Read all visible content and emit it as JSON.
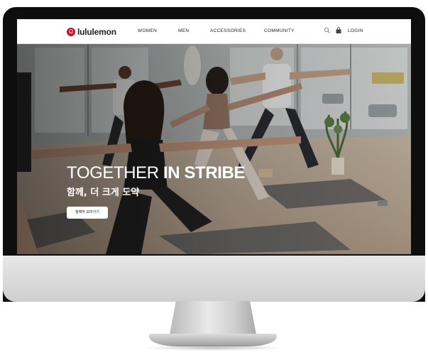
{
  "brand": {
    "name": "lululemon",
    "logo_icon": "lululemon-logo-icon",
    "accent": "#c8102e"
  },
  "nav": {
    "items": [
      "WOMEN",
      "MEN",
      "ACCESSORIES",
      "COMMUNITY"
    ]
  },
  "header": {
    "search_icon": "search-icon",
    "bag_icon": "shopping-bag-icon",
    "login_label": "LOGIN"
  },
  "hero": {
    "headline_light": "TOGETHER ",
    "headline_bold": "IN STRIBE",
    "subheadline": "함께, 더 크게 도약",
    "cta_label": "참해하 보러가기"
  }
}
